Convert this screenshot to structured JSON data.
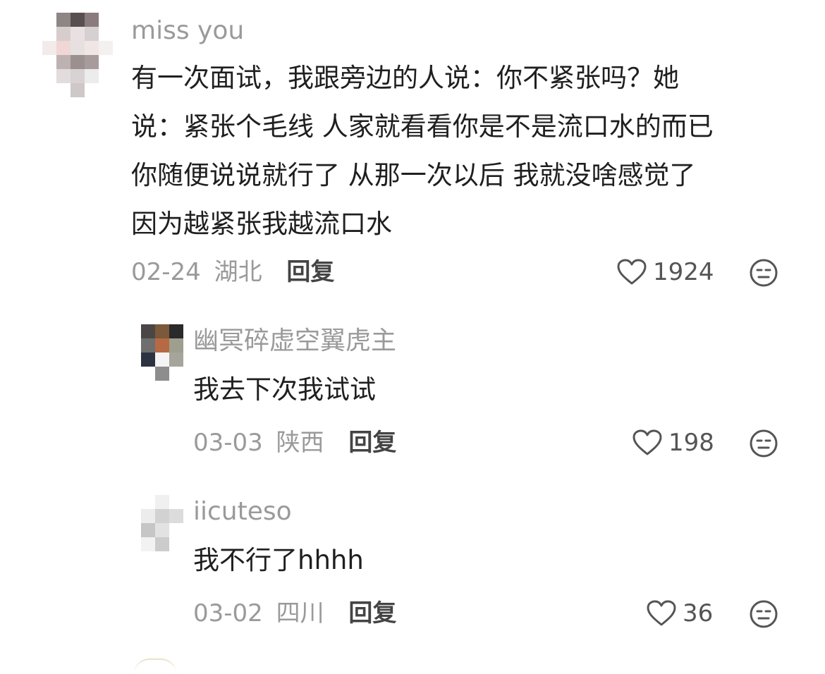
{
  "comment": {
    "username": "miss you",
    "content_lines": [
      "有一次面试，我跟旁边的人说：你不紧张吗？她",
      "说：紧张个毛线 人家就看看你是不是流口水的而已",
      "你随便说说就行了 从那一次以后 我就没啥感觉了",
      "因为越紧张我越流口水"
    ],
    "date": "02-24",
    "location": "湖北",
    "reply_label": "回复",
    "likes": "1924",
    "avatar_colors": [
      "#ffffff",
      "#8e8585",
      "#5a4f50",
      "#8a7c7d",
      "#ffffff",
      "#ffffff",
      "#d8cdcd",
      "#e9e1e1",
      "#d6d0d0",
      "#ffffff",
      "#f3eaea",
      "#f1d6d6",
      "#e6e0e0",
      "#f0e6e6",
      "#f5f0f0",
      "#ffffff",
      "#bdb2b2",
      "#9c8f8f",
      "#a89b9b",
      "#ffffff",
      "#ffffff",
      "#e3dcdc",
      "#d9d2d2",
      "#ececec",
      "#ffffff",
      "#ffffff",
      "#ffffff",
      "#cfc8c8",
      "#ffffff",
      "#ffffff"
    ]
  },
  "replies": [
    {
      "username": "幽冥碎虚空翼虎主",
      "content": "我去下次我试试",
      "date": "03-03",
      "location": "陕西",
      "reply_label": "回复",
      "likes": "198",
      "avatar_colors": [
        "#4b4646",
        "#7a5a3a",
        "#2a2a2a",
        "#6e6e6e",
        "#b56a44",
        "#9f9f8f",
        "#2c3240",
        "#f4f4f4",
        "#a5a59b",
        "#ffffff",
        "#8d8d8d",
        "#ffffff"
      ]
    },
    {
      "username": "iicuteso",
      "content": "我不行了hhhh",
      "date": "03-02",
      "location": "四川",
      "reply_label": "回复",
      "likes": "36",
      "avatar_colors": [
        "#ffffff",
        "#f0f0f0",
        "#ffffff",
        "#ececec",
        "#d2d2d2",
        "#dcdcdc",
        "#c6c6c6",
        "#e2e2e2",
        "#ffffff",
        "#f2f2f2",
        "#cccccc",
        "#ffffff"
      ]
    }
  ],
  "icons": {
    "like": "heart-outline-icon",
    "dislike": "frown-face-icon"
  },
  "colors": {
    "username": "#9a9a9a",
    "text": "#1f1f1f",
    "meta": "#9a9a9a",
    "reply_button": "#444444",
    "icon": "#555555"
  }
}
